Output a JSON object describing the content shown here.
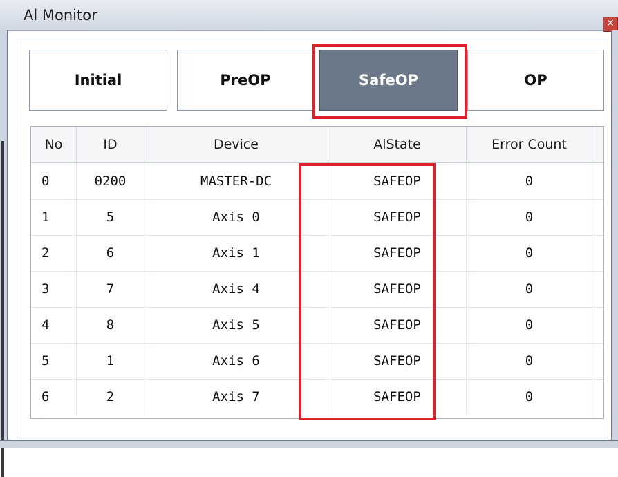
{
  "window": {
    "title": "Al Monitor",
    "close_icon": "close-icon"
  },
  "state_buttons": {
    "initial": "Initial",
    "preop": "PreOP",
    "safeop": "SafeOP",
    "op": "OP"
  },
  "table": {
    "headers": [
      "No",
      "ID",
      "Device",
      "AlState",
      "Error Count"
    ],
    "rows": [
      [
        "0",
        "0200",
        "MASTER-DC",
        "SAFEOP",
        "0"
      ],
      [
        "1",
        "5",
        "Axis 0",
        "SAFEOP",
        "0"
      ],
      [
        "2",
        "6",
        "Axis 1",
        "SAFEOP",
        "0"
      ],
      [
        "3",
        "7",
        "Axis 4",
        "SAFEOP",
        "0"
      ],
      [
        "4",
        "8",
        "Axis 5",
        "SAFEOP",
        "0"
      ],
      [
        "5",
        "1",
        "Axis 6",
        "SAFEOP",
        "0"
      ],
      [
        "6",
        "2",
        "Axis 7",
        "SAFEOP",
        "0"
      ]
    ]
  },
  "colors": {
    "highlight": "#e0202a",
    "selected_button": "#6a7889"
  }
}
